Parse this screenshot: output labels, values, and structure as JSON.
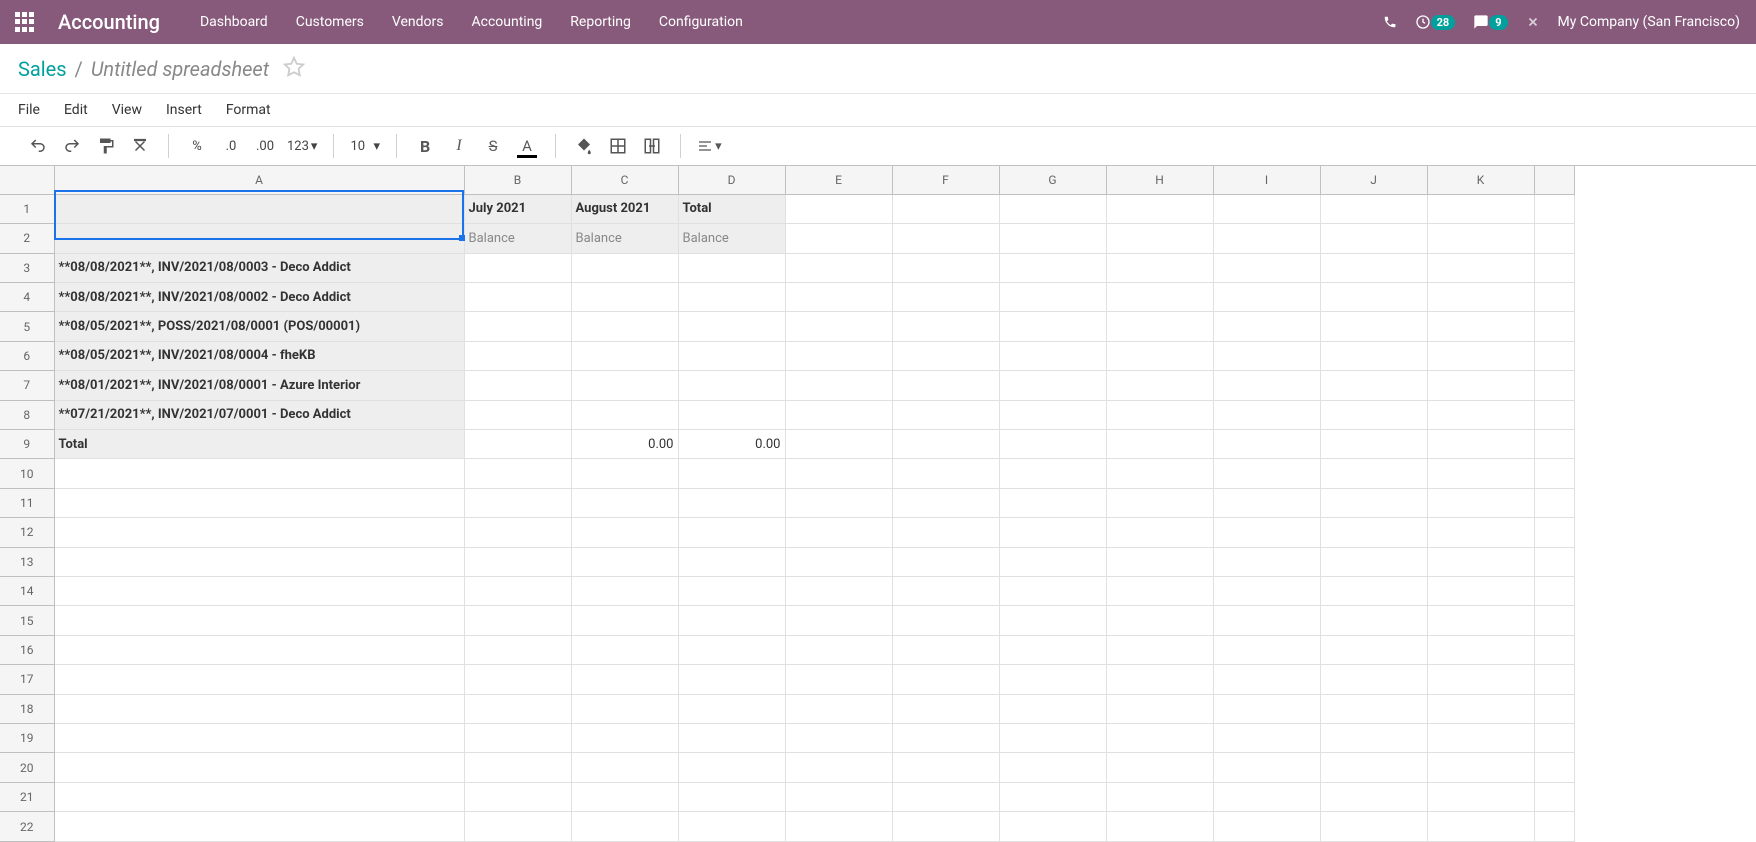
{
  "topnav": {
    "brand": "Accounting",
    "items": [
      "Dashboard",
      "Customers",
      "Vendors",
      "Accounting",
      "Reporting",
      "Configuration"
    ],
    "clock_badge": "28",
    "chat_badge": "9",
    "company": "My Company (San Francisco)"
  },
  "breadcrumb": {
    "root": "Sales",
    "sep": "/",
    "title": "Untitled spreadsheet"
  },
  "menubar": [
    "File",
    "Edit",
    "View",
    "Insert",
    "Format"
  ],
  "toolbar": {
    "percent": "%",
    "dec0": ".0",
    "dec00": ".00",
    "numfmt": "123",
    "fontsize": "10"
  },
  "columns": [
    "A",
    "B",
    "C",
    "D",
    "E",
    "F",
    "G",
    "H",
    "I",
    "J",
    "K"
  ],
  "row_count": 22,
  "header_row1": {
    "B": "July 2021",
    "C": "August 2021",
    "D": "Total"
  },
  "header_row2": {
    "B": "Balance",
    "C": "Balance",
    "D": "Balance"
  },
  "data_rows": [
    "**08/08/2021**, INV/2021/08/0003 - Deco Addict",
    "**08/08/2021**, INV/2021/08/0002 - Deco Addict",
    "**08/05/2021**, POSS/2021/08/0001    (POS/00001)",
    "**08/05/2021**, INV/2021/08/0004 - fheKB",
    "**08/01/2021**, INV/2021/08/0001 - Azure Interior",
    "**07/21/2021**, INV/2021/07/0001 - Deco Addict"
  ],
  "total_row": {
    "A": "Total",
    "C": "0.00",
    "D": "0.00"
  }
}
